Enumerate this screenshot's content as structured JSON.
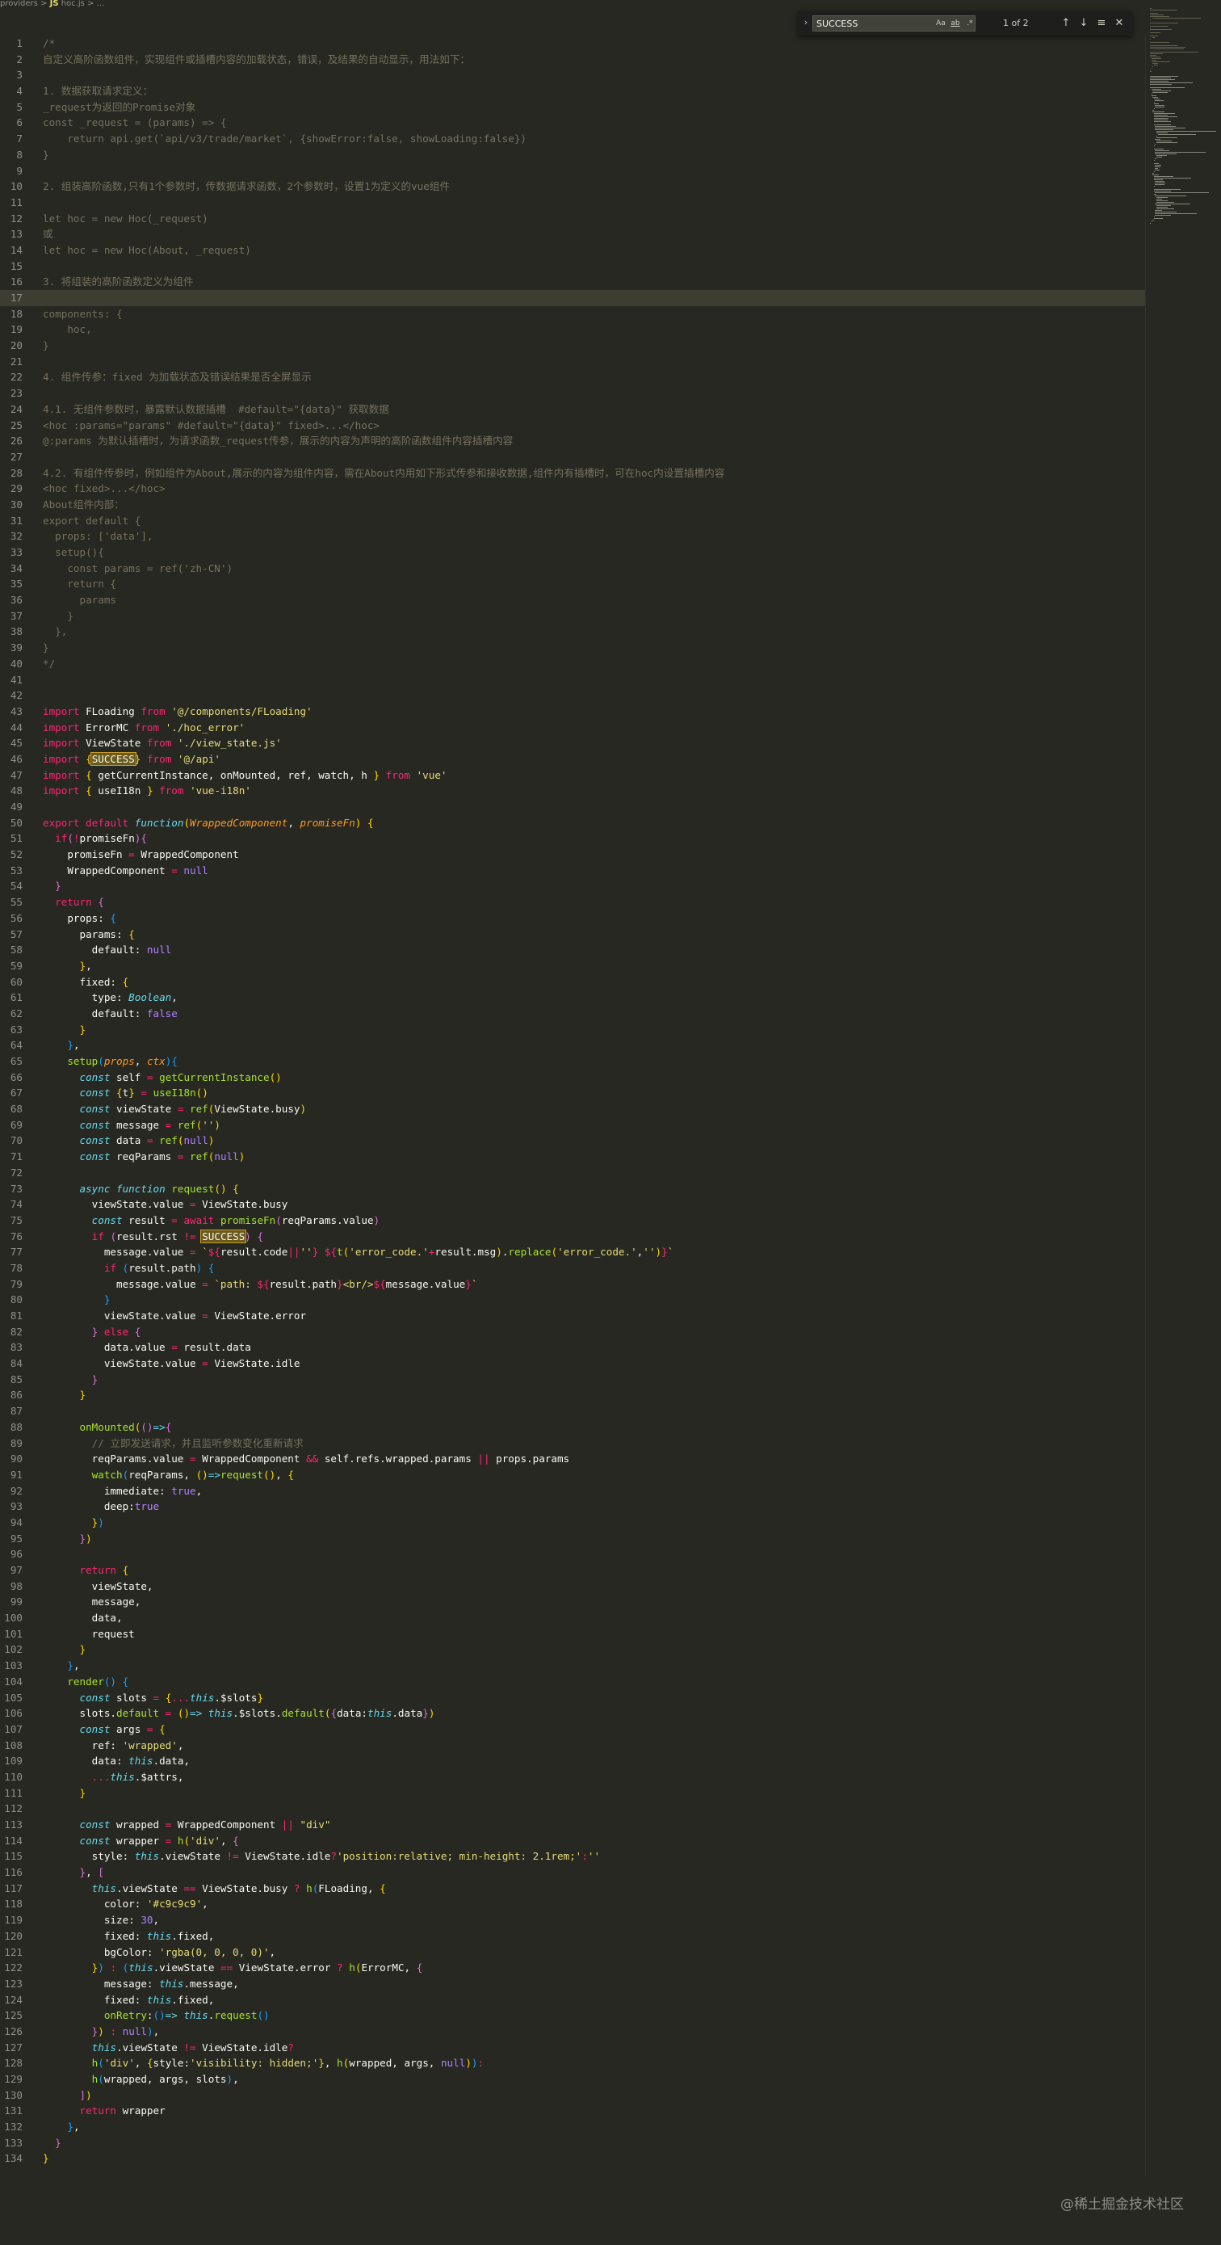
{
  "breadcrumb": {
    "folder": "providers",
    "separator": ">",
    "file_icon": "JS",
    "file": "hoc.js",
    "trail": "> ..."
  },
  "find_widget": {
    "toggle_icon": "chevron-right-icon",
    "query": "SUCCESS",
    "match_case_label": "Aa",
    "whole_word_label": "ab",
    "regex_label": ".*",
    "result_count": "1 of 2",
    "prev_icon": "arrow-up-icon",
    "next_icon": "arrow-down-icon",
    "selection_icon": "find-in-selection-icon",
    "close_icon": "close-icon"
  },
  "editor": {
    "highlighted_line": 17,
    "lines": [
      "<span class=\"c\">/*</span>",
      "<span class=\"c\">自定义高阶函数组件，实现组件或插槽内容的加载状态，错误，及结果的自动显示，用法如下：</span>",
      "",
      "<span class=\"c\">1. 数据获取请求定义：</span>",
      "<span class=\"c\">_request为返回的Promise对象</span>",
      "<span class=\"c\">const _request = (params) =&gt; {</span>",
      "<span class=\"c\">    return api.get(`api/v3/trade/market`, {showError:false, showLoading:false})</span>",
      "<span class=\"c\">}</span>",
      "",
      "<span class=\"c\">2. 组装高阶函数,只有1个参数时，传数据请求函数，2个参数时，设置1为定义的vue组件</span>",
      "",
      "<span class=\"c\">let hoc = new Hoc(_request)</span>",
      "<span class=\"c\">或</span>",
      "<span class=\"c\">let hoc = new Hoc(About, _request)</span>",
      "",
      "<span class=\"c\">3. 将组装的高阶函数定义为组件</span>",
      "",
      "<span class=\"c\">components: {</span>",
      "<span class=\"c\">    hoc,</span>",
      "<span class=\"c\">}</span>",
      "",
      "<span class=\"c\">4. 组件传参：fixed 为加载状态及错误结果是否全屏显示</span>",
      "",
      "<span class=\"c\">4.1. 无组件参数时，暴露默认数据插槽  #default=\"{data}\" 获取数据</span>",
      "<span class=\"c\">&lt;hoc :params=\"params\" #default=\"{data}\" fixed&gt;...&lt;/hoc&gt;</span>",
      "<span class=\"c\">@:params 为默认插槽时，为请求函数_request传参，展示的内容为声明的高阶函数组件内容插槽内容</span>",
      "",
      "<span class=\"c\">4.2. 有组件传参时，例如组件为About,展示的内容为组件内容，需在About内用如下形式传参和接收数据,组件内有插槽时，可在hoc内设置插槽内容</span>",
      "<span class=\"c\">&lt;hoc fixed&gt;...&lt;/hoc&gt;</span>",
      "<span class=\"c\">About组件内部：</span>",
      "<span class=\"c\">export default {</span>",
      "<span class=\"c\">  props: ['data'],</span>",
      "<span class=\"c\">  setup(){</span>",
      "<span class=\"c\">    const params = ref('zh-CN')</span>",
      "<span class=\"c\">    return {</span>",
      "<span class=\"c\">      params</span>",
      "<span class=\"c\">    }</span>",
      "<span class=\"c\">  },</span>",
      "<span class=\"c\">}</span>",
      "<span class=\"c\">*/</span>",
      "",
      "",
      "<span class=\"k\">import</span> FLoading <span class=\"k\">from</span> <span class=\"s\">'@/components/FLoading'</span>",
      "<span class=\"k\">import</span> ErrorMC <span class=\"k\">from</span> <span class=\"s\">'./hoc_error'</span>",
      "<span class=\"k\">import</span> ViewState <span class=\"k\">from</span> <span class=\"s\">'./view_state.js'</span>",
      "<span class=\"k\">import</span> <span class=\"bk1\">{</span><span class=\"m\">SUCCESS</span><span class=\"bk1\">}</span> <span class=\"k\">from</span> <span class=\"s\">'@/api'</span>",
      "<span class=\"k\">import</span> <span class=\"bk1\">{</span> getCurrentInstance, onMounted, ref, watch, h <span class=\"bk1\">}</span> <span class=\"k\">from</span> <span class=\"s\">'vue'</span>",
      "<span class=\"k\">import</span> <span class=\"bk1\">{</span> useI18n <span class=\"bk1\">}</span> <span class=\"k\">from</span> <span class=\"s\">'vue-i18n'</span>",
      "",
      "<span class=\"k\">export</span> <span class=\"k\">default</span> <span class=\"i\">function</span><span class=\"bk1\">(</span><span class=\"p\">WrappedComponent</span>, <span class=\"p\">promiseFn</span><span class=\"bk1\">)</span> <span class=\"bk1\">{</span>",
      "  <span class=\"k\">if</span><span class=\"bk2\">(</span><span class=\"k\">!</span>promiseFn<span class=\"bk2\">){</span>",
      "    promiseFn <span class=\"k\">=</span> WrappedComponent",
      "    WrappedComponent <span class=\"k\">=</span> <span class=\"n\">null</span>",
      "  <span class=\"bk2\">}</span>",
      "  <span class=\"k\">return</span> <span class=\"bk2\">{</span>",
      "    props: <span class=\"bk3\">{</span>",
      "      params: <span class=\"bk1\">{</span>",
      "        default: <span class=\"n\">null</span>",
      "      <span class=\"bk1\">}</span>,",
      "      fixed: <span class=\"bk1\">{</span>",
      "        type: <span class=\"i\">Boolean</span>,",
      "        default: <span class=\"n\">false</span>",
      "      <span class=\"bk1\">}</span>",
      "    <span class=\"bk3\">}</span>,",
      "    <span class=\"f\">setup</span><span class=\"bk3\">(</span><span class=\"p\">props</span>, <span class=\"p\">ctx</span><span class=\"bk3\">){</span>",
      "      <span class=\"i\">const</span> self <span class=\"k\">=</span> <span class=\"f\">getCurrentInstance</span><span class=\"bk1\">()</span>",
      "      <span class=\"i\">const</span> <span class=\"bk1\">{</span>t<span class=\"bk1\">}</span> <span class=\"k\">=</span> <span class=\"f\">useI18n</span><span class=\"bk1\">()</span>",
      "      <span class=\"i\">const</span> viewState <span class=\"k\">=</span> <span class=\"f\">ref</span><span class=\"bk1\">(</span>ViewState.busy<span class=\"bk1\">)</span>",
      "      <span class=\"i\">const</span> message <span class=\"k\">=</span> <span class=\"f\">ref</span><span class=\"bk1\">(</span><span class=\"s\">''</span><span class=\"bk1\">)</span>",
      "      <span class=\"i\">const</span> data <span class=\"k\">=</span> <span class=\"f\">ref</span><span class=\"bk1\">(</span><span class=\"n\">null</span><span class=\"bk1\">)</span>",
      "      <span class=\"i\">const</span> reqParams <span class=\"k\">=</span> <span class=\"f\">ref</span><span class=\"bk1\">(</span><span class=\"n\">null</span><span class=\"bk1\">)</span>",
      "",
      "      <span class=\"i\">async</span> <span class=\"i\">function</span> <span class=\"f\">request</span><span class=\"bk1\">()</span> <span class=\"bk1\">{</span>",
      "        viewState.value <span class=\"k\">=</span> ViewState.busy",
      "        <span class=\"i\">const</span> result <span class=\"k\">=</span> <span class=\"k\">await</span> <span class=\"f\">promiseFn</span><span class=\"bk2\">(</span>reqParams.value<span class=\"bk2\">)</span>",
      "        <span class=\"k\">if</span> <span class=\"bk2\">(</span>result.rst <span class=\"k\">!=</span> <span class=\"m\">SUCCESS</span><span class=\"bk2\">)</span> <span class=\"bk2\">{</span>",
      "          message.value <span class=\"k\">=</span> <span class=\"s\">`</span><span class=\"k\">${</span>result.code<span class=\"k\">||</span><span class=\"s\">''</span><span class=\"k\">}</span><span class=\"s\"> </span><span class=\"k\">${</span><span class=\"f\">t</span><span class=\"bk1\">(</span><span class=\"s\">'error_code.'</span><span class=\"k\">+</span>result.msg<span class=\"bk1\">)</span>.<span class=\"f\">replace</span><span class=\"bk1\">(</span><span class=\"s\">'error_code.'</span>,<span class=\"s\">''</span><span class=\"bk1\">)</span><span class=\"k\">}</span><span class=\"s\">`</span>",
      "          <span class=\"k\">if</span> <span class=\"bk3\">(</span>result.path<span class=\"bk3\">)</span> <span class=\"bk3\">{</span>",
      "            message.value <span class=\"k\">=</span> <span class=\"s\">`path: </span><span class=\"k\">${</span>result.path<span class=\"k\">}</span><span class=\"s\">&lt;br/&gt;</span><span class=\"k\">${</span>message.value<span class=\"k\">}</span><span class=\"s\">`</span>",
      "          <span class=\"bk3\">}</span>",
      "          viewState.value <span class=\"k\">=</span> ViewState.error",
      "        <span class=\"bk2\">}</span> <span class=\"k\">else</span> <span class=\"bk2\">{</span>",
      "          data.value <span class=\"k\">=</span> result.data",
      "          viewState.value <span class=\"k\">=</span> ViewState.idle",
      "        <span class=\"bk2\">}</span>",
      "      <span class=\"bk1\">}</span>",
      "",
      "      <span class=\"f\">onMounted</span><span class=\"bk1\">(</span><span class=\"bk2\">()</span><span class=\"i\">=&gt;</span><span class=\"bk2\">{</span>",
      "        <span class=\"c\">// 立即发送请求，并且监听参数变化重新请求</span>",
      "        reqParams.value <span class=\"k\">=</span> WrappedComponent <span class=\"k\">&amp;&amp;</span> self.refs.wrapped.params <span class=\"k\">||</span> props.params",
      "        <span class=\"f\">watch</span><span class=\"bk3\">(</span>reqParams, <span class=\"bk1\">()</span><span class=\"i\">=&gt;</span><span class=\"f\">request</span><span class=\"bk1\">()</span>, <span class=\"bk1\">{</span>",
      "          immediate: <span class=\"n\">true</span>,",
      "          deep:<span class=\"n\">true</span>",
      "        <span class=\"bk1\">}</span><span class=\"bk3\">)</span>",
      "      <span class=\"bk2\">}</span><span class=\"bk1\">)</span>",
      "",
      "      <span class=\"k\">return</span> <span class=\"bk1\">{</span>",
      "        viewState,",
      "        message,",
      "        data,",
      "        request",
      "      <span class=\"bk1\">}</span>",
      "    <span class=\"bk3\">}</span>,",
      "    <span class=\"f\">render</span><span class=\"bk3\">()</span> <span class=\"bk3\">{</span>",
      "      <span class=\"i\">const</span> slots <span class=\"k\">=</span> <span class=\"bk1\">{</span><span class=\"k\">...</span><span class=\"i\">this</span>.$slots<span class=\"bk1\">}</span>",
      "      slots.<span class=\"f\">default</span> <span class=\"k\">=</span> <span class=\"bk1\">()</span><span class=\"i\">=&gt;</span> <span class=\"i\">this</span>.$slots.<span class=\"f\">default</span><span class=\"bk1\">(</span><span class=\"bk2\">{</span>data:<span class=\"i\">this</span>.data<span class=\"bk2\">}</span><span class=\"bk1\">)</span>",
      "      <span class=\"i\">const</span> args <span class=\"k\">=</span> <span class=\"bk1\">{</span>",
      "        ref: <span class=\"s\">'wrapped'</span>,",
      "        data: <span class=\"i\">this</span>.data,",
      "        <span class=\"k\">...</span><span class=\"i\">this</span>.$attrs,",
      "      <span class=\"bk1\">}</span>",
      "",
      "      <span class=\"i\">const</span> wrapped <span class=\"k\">=</span> WrappedComponent <span class=\"k\">||</span> <span class=\"s\">\"div\"</span>",
      "      <span class=\"i\">const</span> wrapper <span class=\"k\">=</span> <span class=\"f\">h</span><span class=\"bk1\">(</span><span class=\"s\">'div'</span>, <span class=\"bk2\">{</span>",
      "        style: <span class=\"i\">this</span>.viewState <span class=\"k\">!=</span> ViewState.idle<span class=\"k\">?</span><span class=\"s\">'position:relative; min-height: 2.1rem;'</span><span class=\"k\">:</span><span class=\"s\">''</span>",
      "      <span class=\"bk2\">}</span>, <span class=\"bk2\">[</span>",
      "        <span class=\"i\">this</span>.viewState <span class=\"k\">==</span> ViewState.busy <span class=\"k\">?</span> <span class=\"f\">h</span><span class=\"bk3\">(</span>FLoading, <span class=\"bk1\">{</span>",
      "          color: <span class=\"s\">'#c9c9c9'</span>,",
      "          size: <span class=\"n\">30</span>,",
      "          fixed: <span class=\"i\">this</span>.fixed,",
      "          bgColor: <span class=\"s\">'rgba(0, 0, 0, 0)'</span>,",
      "        <span class=\"bk1\">}</span><span class=\"bk3\">)</span> <span class=\"k\">:</span> <span class=\"bk3\">(</span><span class=\"i\">this</span>.viewState <span class=\"k\">==</span> ViewState.error <span class=\"k\">?</span> <span class=\"f\">h</span><span class=\"bk1\">(</span>ErrorMC, <span class=\"bk2\">{</span>",
      "          message: <span class=\"i\">this</span>.message,",
      "          fixed: <span class=\"i\">this</span>.fixed,",
      "          <span class=\"f\">onRetry</span>:<span class=\"bk3\">()</span><span class=\"i\">=&gt;</span> <span class=\"i\">this</span>.<span class=\"f\">request</span><span class=\"bk3\">()</span>",
      "        <span class=\"bk2\">}</span><span class=\"bk1\">)</span> <span class=\"k\">:</span> <span class=\"n\">null</span><span class=\"bk3\">)</span>,",
      "        <span class=\"i\">this</span>.viewState <span class=\"k\">!=</span> ViewState.idle<span class=\"k\">?</span>",
      "        <span class=\"f\">h</span><span class=\"bk3\">(</span><span class=\"s\">'div'</span>, <span class=\"bk1\">{</span>style:<span class=\"s\">'visibility: hidden;'</span><span class=\"bk1\">}</span>, <span class=\"f\">h</span><span class=\"bk1\">(</span>wrapped, args, <span class=\"n\">null</span><span class=\"bk1\">)</span><span class=\"bk3\">)</span><span class=\"k\">:</span>",
      "        <span class=\"f\">h</span><span class=\"bk3\">(</span>wrapped, args, slots<span class=\"bk3\">)</span>,",
      "      <span class=\"bk2\">]</span><span class=\"bk1\">)</span>",
      "      <span class=\"k\">return</span> wrapper",
      "    <span class=\"bk3\">}</span>,",
      "  <span class=\"bk2\">}</span>",
      "<span class=\"bk1\">}</span>"
    ]
  },
  "watermark": "@稀土掘金技术社区"
}
